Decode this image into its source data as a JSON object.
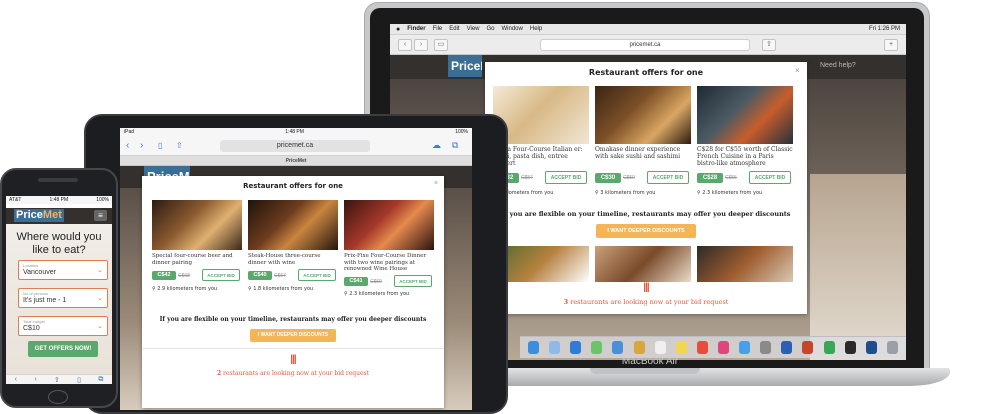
{
  "laptop": {
    "brand": "MacBook Air",
    "menubar": {
      "apple": "",
      "items": [
        "Finder",
        "File",
        "Edit",
        "View",
        "Go",
        "Window",
        "Help"
      ],
      "clock": "Fri 1:26 PM"
    },
    "url": "pricemet.ca",
    "logo": "PriceMet",
    "help": "Need help?",
    "modal": {
      "title": "Restaurant offers for one",
      "offers": [
        {
          "desc": "l for a Four-Course Italian er: primi, pasta dish, entree dessert",
          "price": "C$32",
          "old": "C$57",
          "accept": "ACCEPT BID",
          "distance": "5 kilometers from you"
        },
        {
          "desc": "Omakase dinner experience with sake sushi and sashimi",
          "price": "C$30",
          "old": "C$50",
          "accept": "ACCEPT BID",
          "distance": "3 kilometers from you"
        },
        {
          "desc": "C$28 for C$55 worth of Classic French Cuisine in a Paris bistro-like atmosphere",
          "price": "C$28",
          "old": "C$55",
          "accept": "ACCEPT BID",
          "distance": "2.3 kilometers from you"
        }
      ],
      "flex_text": "If you are flexible on your timeline, restaurants may offer you deeper discounts",
      "deeper_btn": "I WANT DEEPER DISCOUNTS",
      "bid_count": "3",
      "bid_text": "restaurants are looking now at your bid request"
    }
  },
  "tablet": {
    "status_left": "iPad",
    "status_time": "1:48 PM",
    "status_right": "100%",
    "url": "pricemet.ca",
    "tab_title": "PriceMet",
    "logo": "PriceMet",
    "modal": {
      "title": "Restaurant offers for one",
      "offers": [
        {
          "desc": "Special four-course beer and dinner pairing",
          "price": "C$42",
          "old": "C$68",
          "accept": "ACCEPT BID",
          "distance": "2.9 kilometers from you"
        },
        {
          "desc": "Steak-House three-course dinner with wine",
          "price": "C$40",
          "old": "C$67",
          "accept": "ACCEPT BID",
          "distance": "1.8 kilometers from you"
        },
        {
          "desc": "Prix-Fixe Four-Course Dinner with two wine pairings at renowned Wine House",
          "price": "C$41",
          "old": "C$60",
          "accept": "ACCEPT BID",
          "distance": "2.3 kilometers from you"
        }
      ],
      "flex_text": "If you are flexible on your timeline, restaurants may offer you deeper discounts",
      "deeper_btn": "I WANT DEEPER DISCOUNTS",
      "bid_count": "2",
      "bid_text": "restaurants are looking now at your bid request"
    }
  },
  "phone": {
    "carrier": "AT&T",
    "time": "1:48 PM",
    "battery": "100%",
    "url": "pricemet.ca",
    "logo_a": "Price",
    "logo_b": "Met",
    "headline": "Where would you like to eat?",
    "fields": [
      {
        "label": "Location",
        "value": "Vancouver"
      },
      {
        "label": "No of persons",
        "value": "It's just me - 1"
      },
      {
        "label": "Total budget",
        "value": "C$10"
      }
    ],
    "cta": "GET OFFERS NOW!"
  },
  "colors": {
    "accent_green": "#5aa86d",
    "accent_orange": "#f5b455",
    "brand_blue": "#3a6e95",
    "bid_red": "#e05a3c"
  }
}
